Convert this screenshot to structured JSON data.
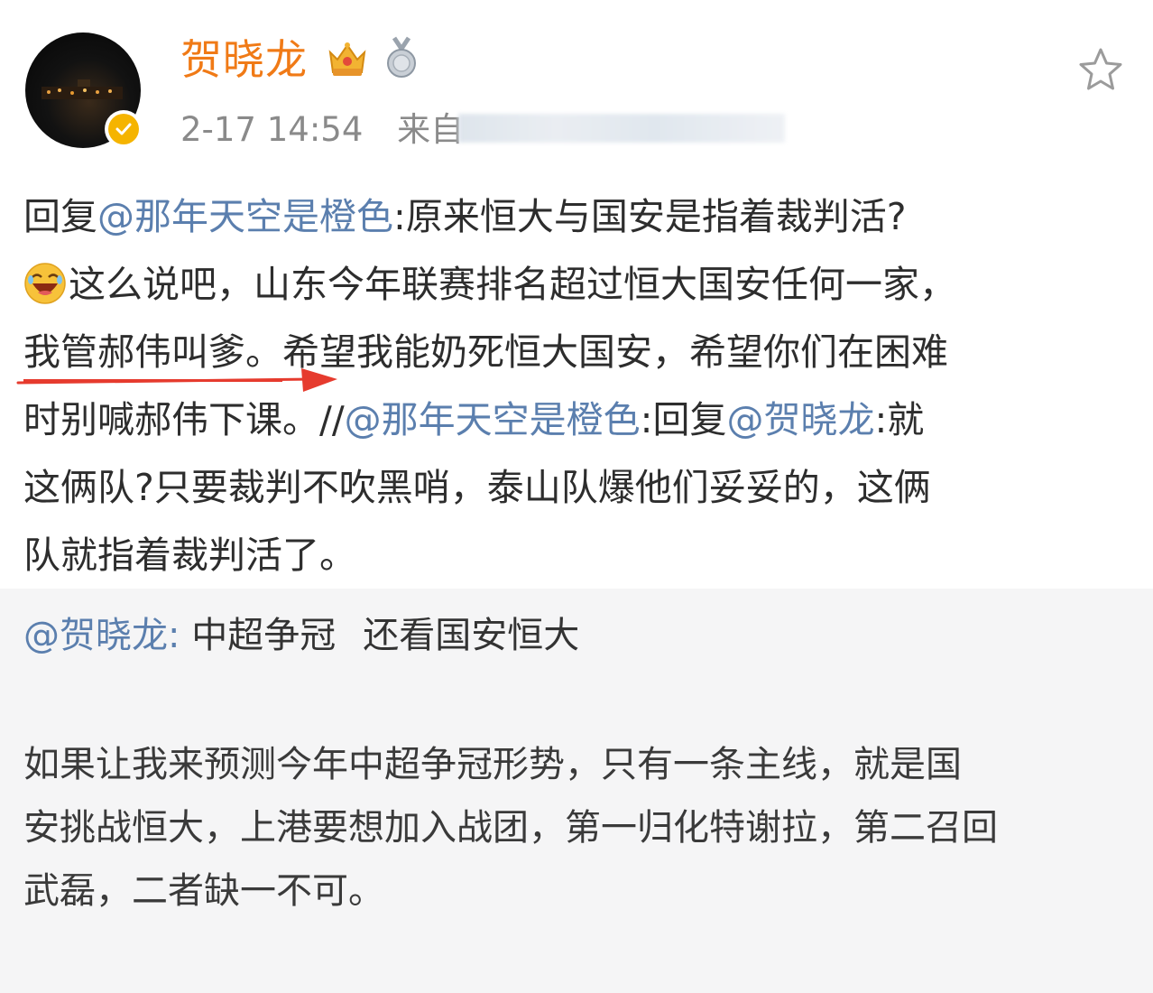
{
  "header": {
    "username": "贺晓龙",
    "timestamp": "2-17 14:54",
    "source_label": "来自",
    "icons": [
      "avatar",
      "verified-badge-icon",
      "vip-crown-icon",
      "medal-icon",
      "star-icon"
    ]
  },
  "post": {
    "line1": {
      "prefix": "回复",
      "mention": "@那年天空是橙色",
      "text": ":原来恒大与国安是指着裁判活?"
    },
    "line2": {
      "emoji": "laugh-emoji-icon",
      "text": "这么说吧，山东今年联赛排名超过恒大国安任何一家，"
    },
    "line3": {
      "underlined": "我管郝伟叫爹。",
      "text": "希望我能奶死恒大国安，希望你们在困难"
    },
    "line4": {
      "text": "时别喊郝伟下课。//",
      "mention1": "@那年天空是橙色",
      "text2": ":回复",
      "mention2": "@贺晓龙",
      "text3": ":就"
    },
    "line5": "这俩队?只要裁判不吹黑哨，泰山队爆他们妥妥的，这俩",
    "line6": "队就指着裁判活了。"
  },
  "quoted": {
    "mention": "@贺晓龙:",
    "title_part1": "中超争冠",
    "title_part2": "还看国安恒大",
    "body_line1": " 如果让我来预测今年中超争冠形势，只有一条主线，就是国",
    "body_line2": "安挑战恒大，上港要想加入战团，第一归化特谢拉，第二召回",
    "body_line3": "武磊，二者缺一不可。"
  },
  "colors": {
    "username": "#f07a16",
    "mention": "#5b7fae",
    "meta": "#8a8a8a",
    "annotation_red": "#e63b2e",
    "quoted_bg": "#f5f5f6"
  }
}
